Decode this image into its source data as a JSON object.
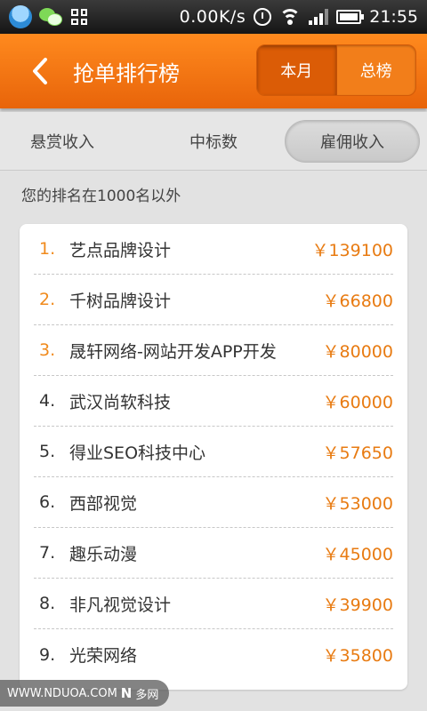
{
  "status_bar": {
    "speed": "0.00K/s",
    "time": "21:55",
    "icons": [
      "qq-icon",
      "wechat-icon",
      "grid-icon",
      "alarm-icon",
      "wifi-icon",
      "signal-icon",
      "battery-icon"
    ]
  },
  "header": {
    "title": "抢单排行榜",
    "back_icon": "chevron-left-icon",
    "segments": [
      {
        "label": "本月",
        "active": true
      },
      {
        "label": "总榜",
        "active": false
      }
    ]
  },
  "tabs": [
    {
      "label": "悬赏收入",
      "active": false
    },
    {
      "label": "中标数",
      "active": false
    },
    {
      "label": "雇佣收入",
      "active": true
    }
  ],
  "rank_note": "您的排名在1000名以外",
  "ranking": [
    {
      "rank": "1.",
      "name": "艺点品牌设计",
      "amount": "￥139100"
    },
    {
      "rank": "2.",
      "name": "千树品牌设计",
      "amount": "￥66800"
    },
    {
      "rank": "3.",
      "name": "晟轩网络-网站开发APP开发",
      "amount": "￥80000"
    },
    {
      "rank": "4.",
      "name": "武汉尚软科技",
      "amount": "￥60000"
    },
    {
      "rank": "5.",
      "name": "得业SEO科技中心",
      "amount": "￥57650"
    },
    {
      "rank": "6.",
      "name": "西部视觉",
      "amount": "￥53000"
    },
    {
      "rank": "7.",
      "name": "趣乐动漫",
      "amount": "￥45000"
    },
    {
      "rank": "8.",
      "name": "非凡视觉设计",
      "amount": "￥39900"
    },
    {
      "rank": "9.",
      "name": "光荣网络",
      "amount": "￥35800"
    }
  ],
  "watermark": {
    "site": "WWW.NDUOA.COM",
    "mark": "N",
    "brand": "多网"
  },
  "colors": {
    "accent": "#f08a1c",
    "header": "#e8640a",
    "amount": "#e87b12"
  }
}
